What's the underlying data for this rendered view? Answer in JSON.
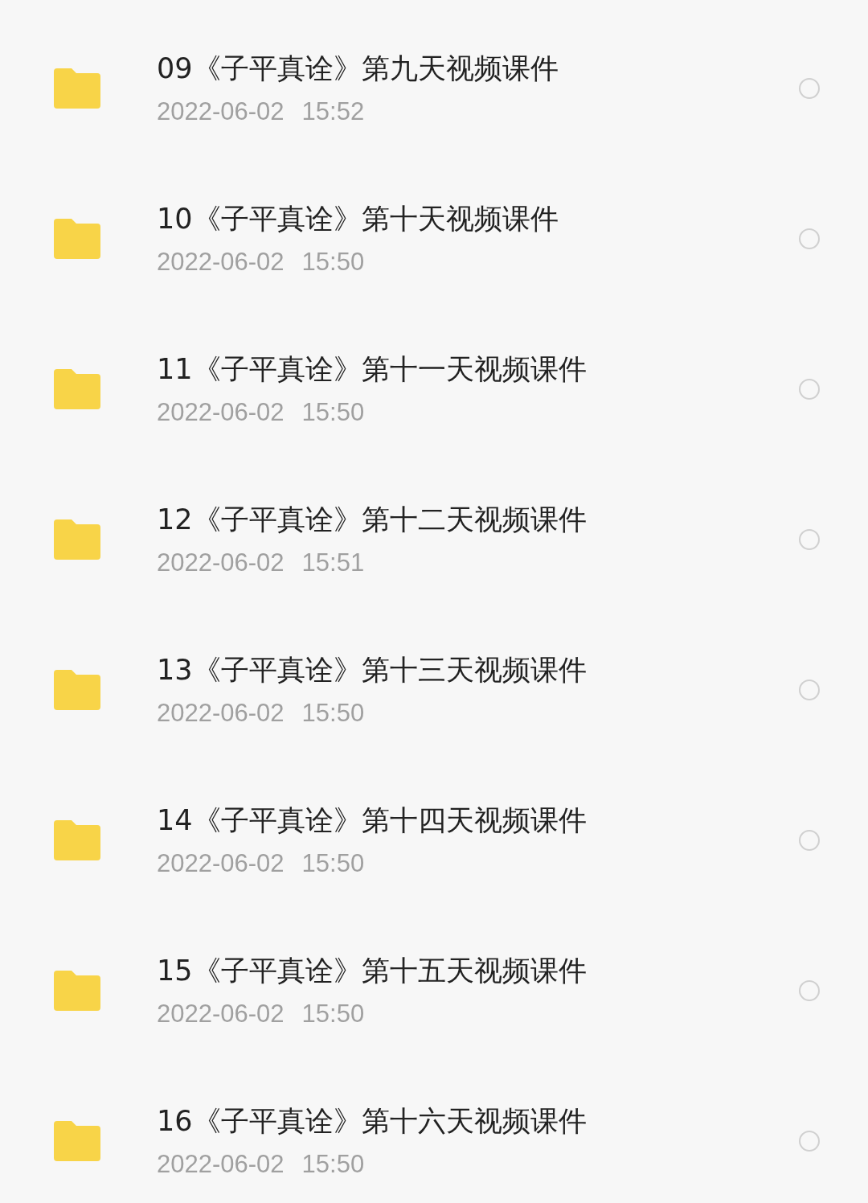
{
  "files": [
    {
      "name": "09《子平真诠》第九天视频课件",
      "date": "2022-06-02",
      "time": "15:52",
      "selected": false
    },
    {
      "name": "10《子平真诠》第十天视频课件",
      "date": "2022-06-02",
      "time": "15:50",
      "selected": false
    },
    {
      "name": "11《子平真诠》第十一天视频课件",
      "date": "2022-06-02",
      "time": "15:50",
      "selected": false
    },
    {
      "name": "12《子平真诠》第十二天视频课件",
      "date": "2022-06-02",
      "time": "15:51",
      "selected": false
    },
    {
      "name": "13《子平真诠》第十三天视频课件",
      "date": "2022-06-02",
      "time": "15:50",
      "selected": false
    },
    {
      "name": "14《子平真诠》第十四天视频课件",
      "date": "2022-06-02",
      "time": "15:50",
      "selected": false
    },
    {
      "name": "15《子平真诠》第十五天视频课件",
      "date": "2022-06-02",
      "time": "15:50",
      "selected": false
    },
    {
      "name": "16《子平真诠》第十六天视频课件",
      "date": "2022-06-02",
      "time": "15:50",
      "selected": false
    }
  ]
}
